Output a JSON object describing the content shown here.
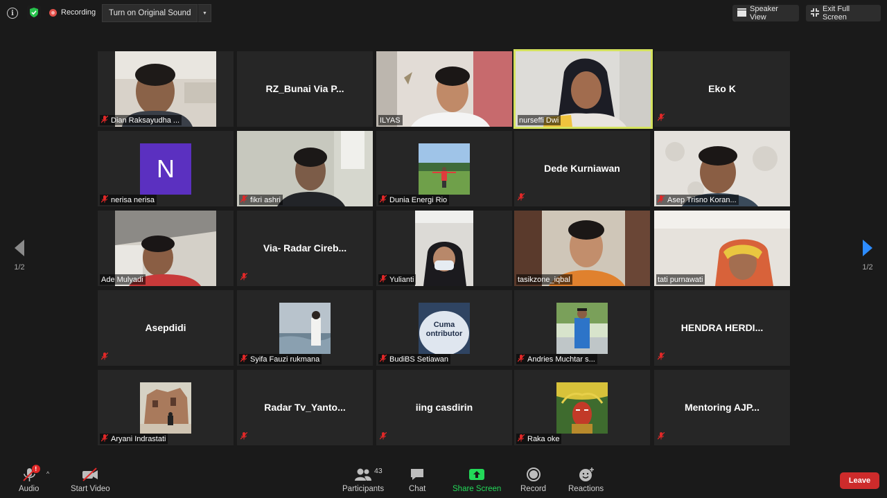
{
  "topbar": {
    "recording_label": "Recording",
    "original_sound_label": "Turn on Original Sound",
    "speaker_view_label": "Speaker View",
    "exit_fullscreen_label": "Exit Full Screen"
  },
  "grid": {
    "tiles": [
      {
        "name": "Dian Raksayudha ...",
        "kind": "video",
        "muted": true
      },
      {
        "name": "RZ_Bunai Via P...",
        "kind": "name",
        "muted": false
      },
      {
        "name": "ILYAS",
        "kind": "video",
        "muted": false
      },
      {
        "name": "nurseffi Dwi",
        "kind": "video",
        "muted": false,
        "active": true
      },
      {
        "name": "Eko K",
        "kind": "name",
        "muted": true
      },
      {
        "name": "nerisa nerisa",
        "kind": "initial",
        "initial": "N",
        "initial_color": "#5b30c0",
        "muted": true
      },
      {
        "name": "fikri ashri",
        "kind": "video",
        "muted": true
      },
      {
        "name": "Dunia Energi Rio",
        "kind": "photo",
        "muted": true
      },
      {
        "name": "Dede Kurniawan",
        "kind": "name",
        "muted": true
      },
      {
        "name": "Asep Trisno Koran...",
        "kind": "video",
        "muted": true
      },
      {
        "name": "Ade Mulyadi",
        "kind": "video",
        "muted": false
      },
      {
        "name": "Via-  Radar  Cireb...",
        "kind": "name",
        "muted": true
      },
      {
        "name": "Yulianti",
        "kind": "video",
        "muted": true
      },
      {
        "name": "tasikzone_iqbal",
        "kind": "video",
        "muted": false
      },
      {
        "name": "tati purnawati",
        "kind": "video",
        "muted": false
      },
      {
        "name": "Asepdidi",
        "kind": "name",
        "muted": true
      },
      {
        "name": "Syifa Fauzi rukmana",
        "kind": "photo",
        "muted": true
      },
      {
        "name": "BudiBS Setiawan",
        "kind": "photo",
        "muted": true
      },
      {
        "name": "Andries Muchtar s...",
        "kind": "photo",
        "muted": true
      },
      {
        "name": "HENDRA  HERDI...",
        "kind": "name",
        "muted": true
      },
      {
        "name": "Aryani Indrastati",
        "kind": "photo",
        "muted": true
      },
      {
        "name": "Radar  Tv_Yanto...",
        "kind": "name",
        "muted": true
      },
      {
        "name": "iing casdirin",
        "kind": "name",
        "muted": true
      },
      {
        "name": "Raka oke",
        "kind": "photo",
        "muted": true
      },
      {
        "name": "Mentoring  AJP...",
        "kind": "name",
        "muted": true
      }
    ],
    "thumb_text_cuma": "Cuma",
    "thumb_text_contributor": "ontributor"
  },
  "pagination": {
    "left_page": "1/2",
    "right_page": "1/2"
  },
  "toolbar": {
    "audio_label": "Audio",
    "audio_badge": "!",
    "video_label": "Start Video",
    "participants_label": "Participants",
    "participants_count": "43",
    "chat_label": "Chat",
    "share_label": "Share Screen",
    "record_label": "Record",
    "reactions_label": "Reactions",
    "leave_label": "Leave"
  },
  "colors": {
    "share_green": "#23d959",
    "leave_red": "#cd2b2b",
    "active_border": "#d4e25e",
    "nav_blue": "#2d8cff"
  }
}
